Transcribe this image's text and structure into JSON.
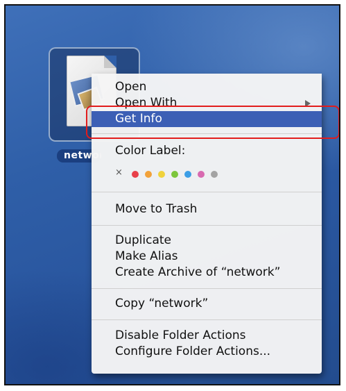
{
  "desktop": {
    "file_label": "network"
  },
  "context_menu": {
    "items": {
      "open": "Open",
      "open_with": "Open With",
      "get_info": "Get Info",
      "color_label": "Color Label:",
      "clear_label": "×",
      "move_to_trash": "Move to Trash",
      "duplicate": "Duplicate",
      "make_alias": "Make Alias",
      "create_archive": "Create Archive of “network”",
      "copy": "Copy “network”",
      "disable_folder_actions": "Disable Folder Actions",
      "configure_folder_actions": "Configure Folder Actions..."
    },
    "selected_item": "Get Info",
    "color_swatches": [
      {
        "name": "red",
        "color": "#e8404a"
      },
      {
        "name": "orange",
        "color": "#f2a23a"
      },
      {
        "name": "yellow",
        "color": "#f0d23c"
      },
      {
        "name": "green",
        "color": "#7cc63c"
      },
      {
        "name": "blue",
        "color": "#3c9ee6"
      },
      {
        "name": "purple",
        "color": "#d86ab0"
      },
      {
        "name": "gray",
        "color": "#a3a3a3"
      }
    ]
  },
  "annotation": {
    "highlight_color": "#e21c1c",
    "highlighted_item": "Get Info"
  },
  "icons": {
    "file_icon": "document-with-photos-icon",
    "submenu_icon": "submenu-arrow-icon",
    "no_label_icon": "x-icon"
  }
}
